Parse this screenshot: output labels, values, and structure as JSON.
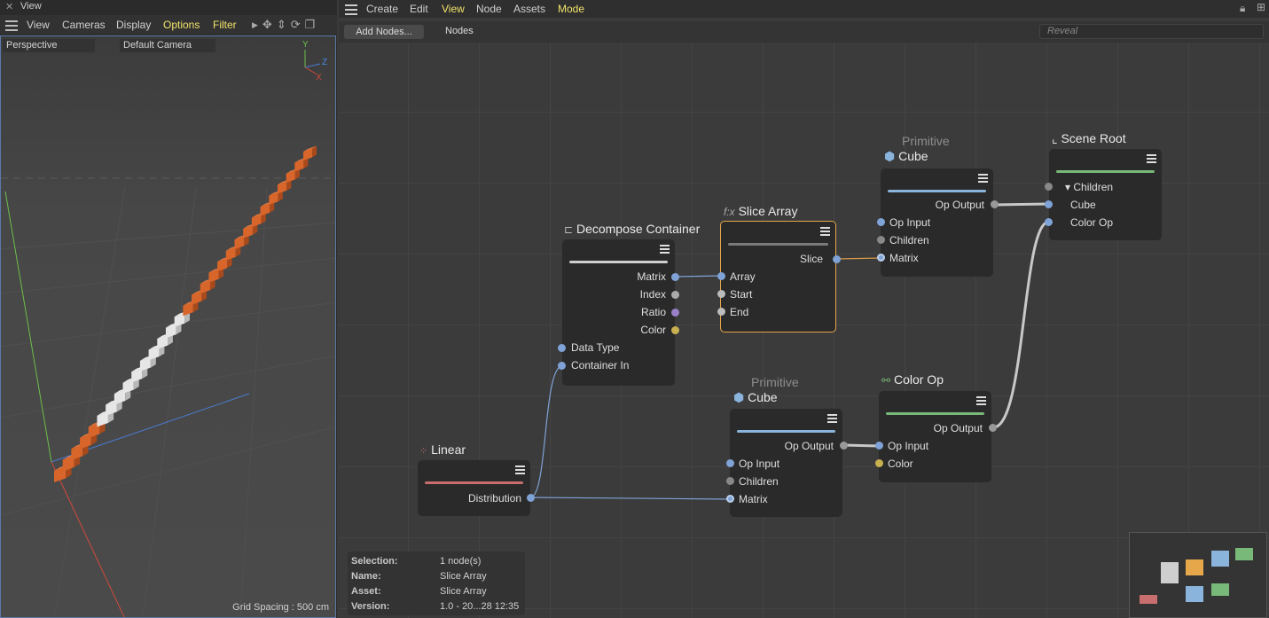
{
  "left_panel": {
    "title": "View",
    "menu": [
      "View",
      "Cameras",
      "Display",
      "Options",
      "Filter"
    ],
    "projection": "Perspective",
    "camera": "Default Camera",
    "axis_labels": {
      "y": "Y",
      "z": "Z",
      "x": "X"
    },
    "grid_spacing": "Grid Spacing : 500 cm"
  },
  "editor": {
    "menu": [
      "Create",
      "Edit",
      "View",
      "Node",
      "Assets",
      "Mode"
    ],
    "add_nodes": "Add Nodes...",
    "nodes_label": "Nodes",
    "reveal_placeholder": "Reveal",
    "nodes": {
      "decompose": {
        "title": "Decompose Container",
        "outputs": [
          "Matrix",
          "Index",
          "Ratio",
          "Color"
        ],
        "inputs": [
          "Data Type",
          "Container In"
        ]
      },
      "slice": {
        "title": "Slice Array",
        "icon": "f:x",
        "output": "Slice",
        "inputs": [
          "Array",
          "Start",
          "End"
        ]
      },
      "cube1": {
        "sub": "Primitive",
        "title": "Cube",
        "output": "Op Output",
        "inputs": [
          "Op Input",
          "Children",
          "Matrix"
        ]
      },
      "scene_root": {
        "title": "Scene Root",
        "inputs": [
          "Children",
          "Cube",
          "Color Op"
        ]
      },
      "linear": {
        "title": "Linear",
        "output": "Distribution"
      },
      "cube2": {
        "sub": "Primitive",
        "title": "Cube",
        "output": "Op Output",
        "inputs": [
          "Op Input",
          "Children",
          "Matrix"
        ]
      },
      "color_op": {
        "title": "Color Op",
        "output": "Op Output",
        "inputs": [
          "Op Input",
          "Color"
        ]
      }
    },
    "info": {
      "selection_label": "Selection:",
      "selection": "1 node(s)",
      "name_label": "Name:",
      "name": "Slice Array",
      "asset_label": "Asset:",
      "asset": "Slice Array",
      "version_label": "Version:",
      "version": "1.0 - 20...28 12:35"
    }
  },
  "colors": {
    "menu_highlight": "#f2e36a",
    "selection_border": "#e6a64a",
    "matrix_port": "#7fa3d6",
    "color_port": "#c8b050",
    "ratio_port": "#9a80c8",
    "cube_bar": "#8ab4dc",
    "color_op_bar": "#78b878",
    "linear_bar": "#c86e6e",
    "cube_orange": "#d8652a"
  }
}
